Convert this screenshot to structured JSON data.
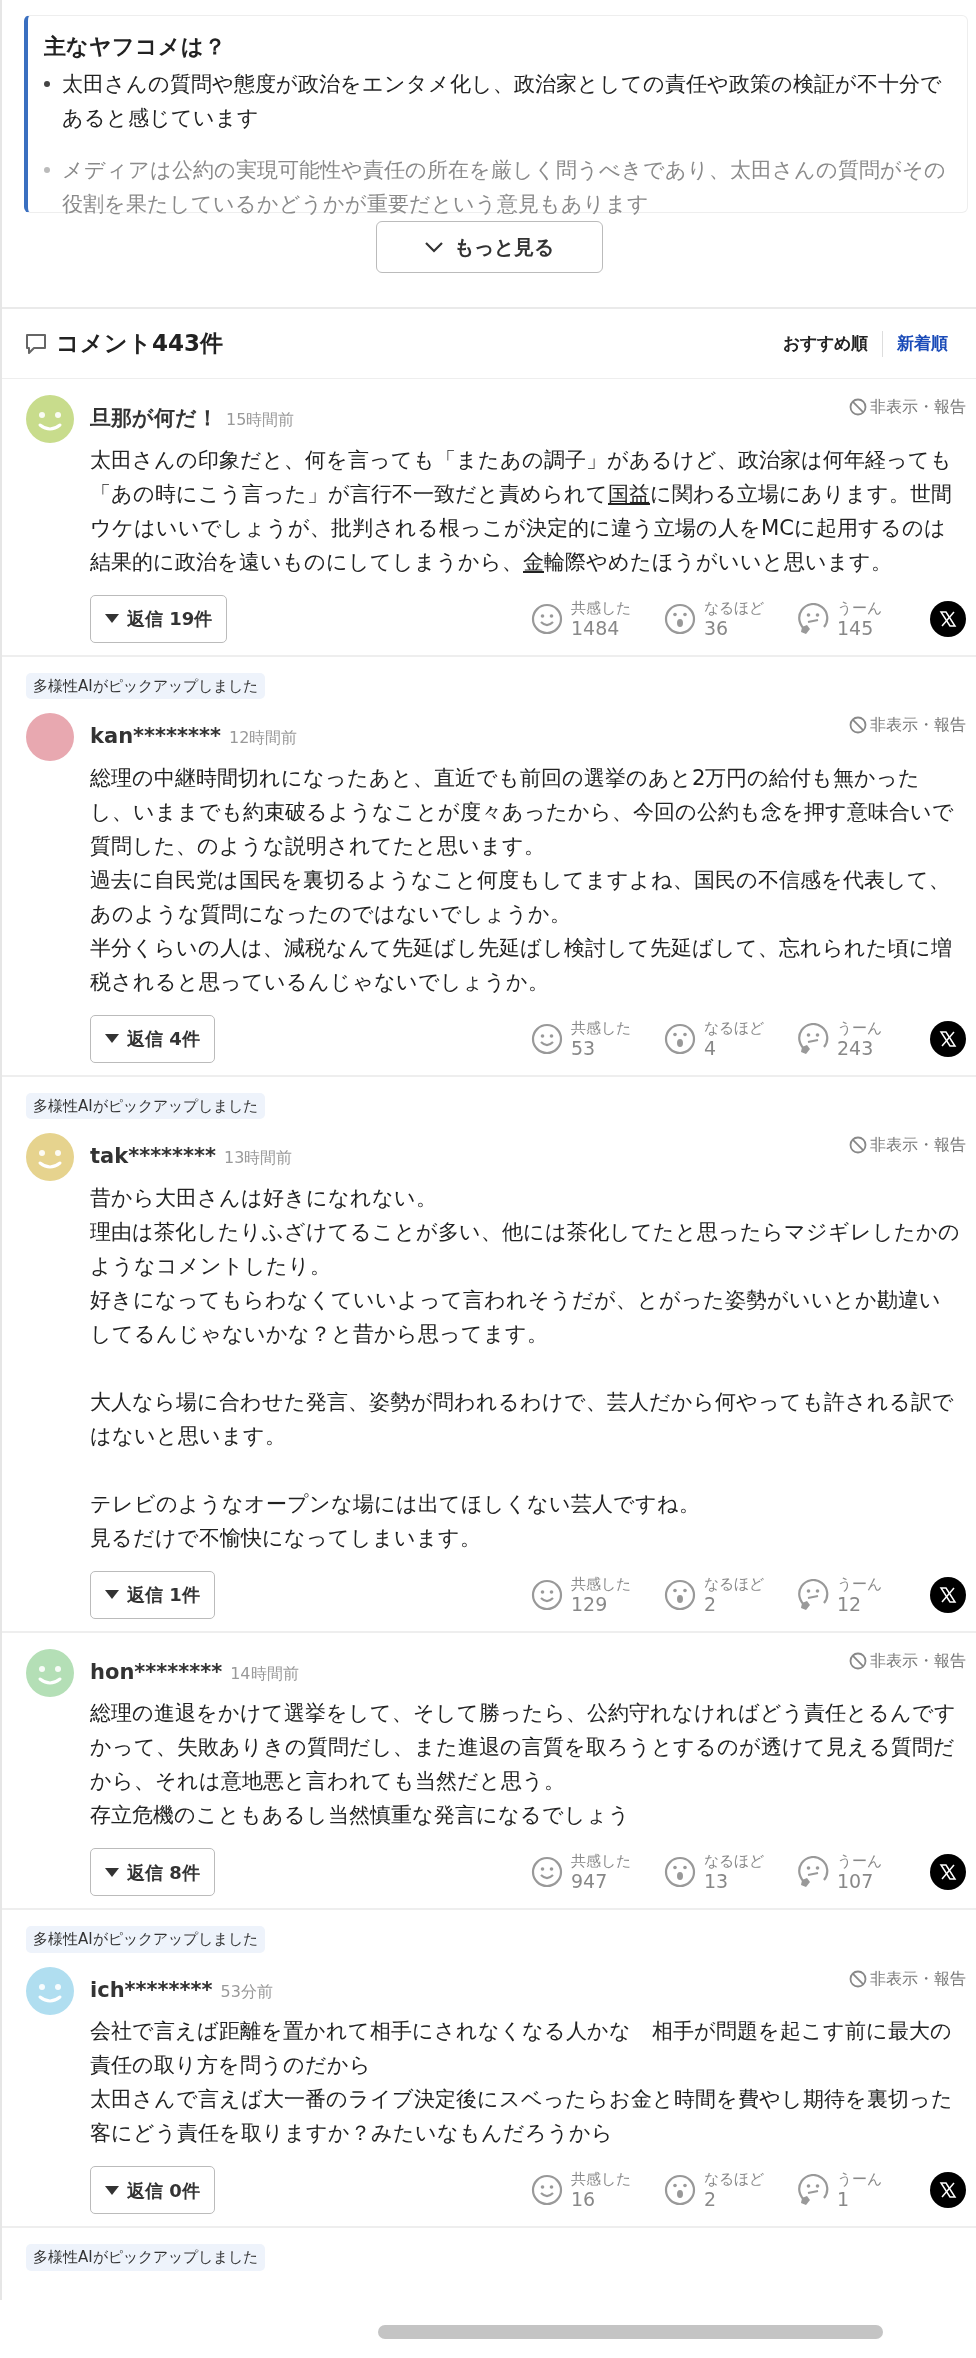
{
  "summary": {
    "title": "主なヤフコメは？",
    "bullets": [
      {
        "text": "太田さんの質問や態度が政治をエンタメ化し、政治家としての責任や政策の検証が不十分であると感じています",
        "faded": false
      },
      {
        "text": "メディアは公約の実現可能性や責任の所在を厳しく問うべきであり、太田さんの質問がその役割を果たしているかどうかが重要だという意見もあります",
        "faded": true
      }
    ],
    "more_button": "もっと見る"
  },
  "comments_header": {
    "title": "コメント443件",
    "sort_tabs": [
      {
        "label": "おすすめ順",
        "selected": true
      },
      {
        "label": "新着順",
        "selected": false
      }
    ]
  },
  "comments": [
    {
      "avatar": {
        "kind": "smiley",
        "color": "#c8dc8c"
      },
      "user": "旦那が何だ！",
      "time": "15時間前",
      "hide_report": "非表示・報告",
      "body": [
        [
          [
            {
              "text": "太田さんの印象だと、何を言っても「またあの調子」があるけど、政治家は何年経っても「あの時にこう言った」が言行不一致だと責められて",
              "keyword": false
            },
            {
              "text": "国益",
              "keyword": true
            },
            {
              "text": "に関わる立場にあります。世間ウケはいいでしょうが、批判される根っこが決定的に違う立場の人をMCに起用するのは結果的に政治を遠いものにしてしまうから、",
              "keyword": false
            },
            {
              "text": "金",
              "keyword": true
            },
            {
              "text": "輪際やめたほうがいいと思います。",
              "keyword": false
            }
          ]
        ]
      ],
      "replies": "返信 19件",
      "reactions": [
        {
          "label": "共感した",
          "count": "1484"
        },
        {
          "label": "なるほど",
          "count": "36"
        },
        {
          "label": "うーん",
          "count": "145"
        }
      ]
    },
    {
      "ai_badge": "多様性AIがピックアップしました",
      "avatar": {
        "kind": "photo",
        "color": "#e8a8b0"
      },
      "user": "kan********",
      "time": "12時間前",
      "hide_report": "非表示・報告",
      "body": [
        [
          "総理の中継時間切れになったあと、直近でも前回の選挙のあと2万円の給付も無かったし、いままでも約束破るようなことが度々あったから、今回の公約も念を押す意味合いで質問した、のような説明されてたと思います。",
          "過去に自民党は国民を裏切るようなこと何度もしてますよね、国民の不信感を代表して、あのような質問になったのではないでしょうか。",
          "半分くらいの人は、減税なんて先延ばし先延ばし検討して先延ばして、忘れられた頃に増税されると思っているんじゃないでしょうか。"
        ]
      ],
      "replies": "返信 4件",
      "reactions": [
        {
          "label": "共感した",
          "count": "53"
        },
        {
          "label": "なるほど",
          "count": "4"
        },
        {
          "label": "うーん",
          "count": "243"
        }
      ]
    },
    {
      "ai_badge": "多様性AIがピックアップしました",
      "avatar": {
        "kind": "smiley",
        "color": "#e6d38e"
      },
      "user": "tak********",
      "time": "13時間前",
      "hide_report": "非表示・報告",
      "body": [
        [
          "昔から大田さんは好きになれない。",
          "理由は茶化したりふざけてることが多い、他には茶化してたと思ったらマジギレしたかのようなコメントしたり。",
          "好きになってもらわなくていいよって言われそうだが、とがった姿勢がいいとか勘違いしてるんじゃないかな？と昔から思ってます。"
        ],
        [
          "大人なら場に合わせた発言、姿勢が問われるわけで、芸人だから何やっても許される訳ではないと思います。"
        ],
        [
          "テレビのようなオープンな場には出てほしくない芸人ですね。",
          "見るだけで不愉快になってしまいます。"
        ]
      ],
      "replies": "返信 1件",
      "reactions": [
        {
          "label": "共感した",
          "count": "129"
        },
        {
          "label": "なるほど",
          "count": "2"
        },
        {
          "label": "うーん",
          "count": "12"
        }
      ]
    },
    {
      "avatar": {
        "kind": "smiley",
        "color": "#b4dfb6"
      },
      "user": "hon********",
      "time": "14時間前",
      "hide_report": "非表示・報告",
      "body": [
        [
          "総理の進退をかけて選挙をして、そして勝ったら、公約守れなければどう責任とるんですかって、失敗ありきの質問だし、また進退の言質を取ろうとするのが透けて見える質問だから、それは意地悪と言われても当然だと思う。",
          "存立危機のこともあるし当然慎重な発言になるでしょう"
        ]
      ],
      "replies": "返信 8件",
      "reactions": [
        {
          "label": "共感した",
          "count": "947"
        },
        {
          "label": "なるほど",
          "count": "13"
        },
        {
          "label": "うーん",
          "count": "107"
        }
      ]
    },
    {
      "ai_badge": "多様性AIがピックアップしました",
      "avatar": {
        "kind": "smiley",
        "color": "#b0def0"
      },
      "user": "ich********",
      "time": "53分前",
      "hide_report": "非表示・報告",
      "body": [
        [
          "会社で言えば距離を置かれて相手にされなくなる人かな　相手が問題を起こす前に最大の責任の取り方を問うのだから",
          "太田さんで言えば大一番のライブ決定後にスベったらお金と時間を費やし期待を裏切った客にどう責任を取りますか？みたいなもんだろうから"
        ]
      ],
      "replies": "返信 0件",
      "reactions": [
        {
          "label": "共感した",
          "count": "16"
        },
        {
          "label": "なるほど",
          "count": "2"
        },
        {
          "label": "うーん",
          "count": "1"
        }
      ]
    }
  ],
  "next_comment": {
    "ai_badge": "多様性AIがピックアップしました"
  }
}
